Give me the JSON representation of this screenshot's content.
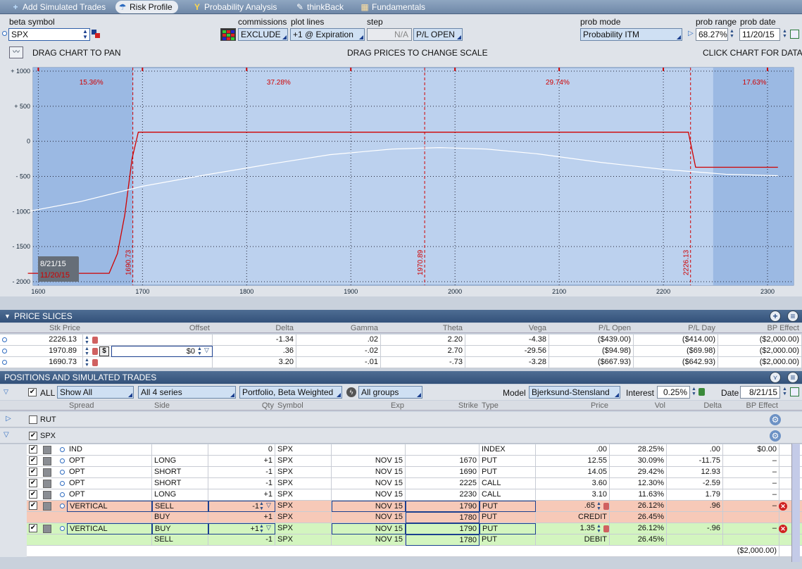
{
  "tabs": [
    {
      "label": "Add Simulated Trades",
      "icon": "+"
    },
    {
      "label": "Risk Profile",
      "icon": "☂"
    },
    {
      "label": "Probability Analysis",
      "icon": "Y"
    },
    {
      "label": "thinkBack",
      "icon": "✎"
    },
    {
      "label": "Fundamentals",
      "icon": "▦"
    }
  ],
  "controls": {
    "beta_symbol_label": "beta symbol",
    "beta_symbol": "SPX",
    "commissions_label": "commissions",
    "commissions": "EXCLUDE",
    "plot_lines_label": "plot lines",
    "plot_lines": "+1 @ Expiration",
    "step_label": "step",
    "step": "N/A",
    "pl_mode": "P/L OPEN",
    "prob_mode_label": "prob mode",
    "prob_mode": "Probability ITM",
    "prob_range_label": "prob range",
    "prob_range": "68.27%",
    "prob_date_label": "prob date",
    "prob_date": "11/20/15",
    "drag_pan": "DRAG CHART TO PAN",
    "drag_prices": "DRAG PRICES TO CHANGE SCALE",
    "click_chart": "CLICK CHART FOR DATA"
  },
  "chart_data": {
    "type": "line",
    "x_ticks": [
      "1600",
      "1700",
      "1800",
      "1900",
      "2000",
      "2100",
      "2200",
      "2300"
    ],
    "y_ticks": [
      "+ 1000",
      "+ 500",
      "0",
      "- 500",
      "- 1000",
      "- 1500",
      "- 2000"
    ],
    "xlim": [
      1595,
      2325
    ],
    "ylim": [
      -2050,
      1050
    ],
    "probabilities": [
      "15.36%",
      "37.28%",
      "29.74%",
      "17.63%"
    ],
    "markers": [
      {
        "x": 1690.73,
        "label": "1690.73"
      },
      {
        "x": 1970.89,
        "label": "1970.89"
      },
      {
        "x": 2226.13,
        "label": "2226.13"
      }
    ],
    "prob_bounds": [
      1690.73,
      2226.13
    ],
    "date_labels": [
      "8/21/15",
      "11/20/15"
    ],
    "series": [
      {
        "color": "#d00000",
        "points": [
          [
            1590,
            -1880
          ],
          [
            1668,
            -1880
          ],
          [
            1676,
            -1600
          ],
          [
            1683,
            -1050
          ],
          [
            1690,
            -250
          ],
          [
            1696,
            130
          ],
          [
            2224,
            130
          ],
          [
            2231,
            -370
          ],
          [
            2310,
            -370
          ]
        ]
      },
      {
        "color": "#ffffff",
        "points": [
          [
            1590,
            -1000
          ],
          [
            1640,
            -860
          ],
          [
            1700,
            -640
          ],
          [
            1760,
            -480
          ],
          [
            1820,
            -330
          ],
          [
            1880,
            -190
          ],
          [
            1940,
            -110
          ],
          [
            1985,
            -90
          ],
          [
            2030,
            -110
          ],
          [
            2080,
            -180
          ],
          [
            2140,
            -300
          ],
          [
            2200,
            -400
          ],
          [
            2260,
            -470
          ],
          [
            2310,
            -490
          ]
        ]
      }
    ]
  },
  "price_slices": {
    "title": "PRICE SLICES",
    "headers": [
      "Stk Price",
      "Offset",
      "Delta",
      "Gamma",
      "Theta",
      "Vega",
      "P/L Open",
      "P/L Day",
      "BP Effect"
    ],
    "rows": [
      {
        "price": "2226.13",
        "offset": "",
        "delta": "-1.34",
        "gamma": ".02",
        "theta": "2.20",
        "vega": "-4.38",
        "pl_open": "($439.00)",
        "pl_day": "($414.00)",
        "bp": "($2,000.00)"
      },
      {
        "price": "1970.89",
        "offset": "$0",
        "delta": ".36",
        "gamma": "-.02",
        "theta": "2.70",
        "vega": "-29.56",
        "pl_open": "($94.98)",
        "pl_day": "($69.98)",
        "bp": "($2,000.00)"
      },
      {
        "price": "1690.73",
        "offset": "",
        "delta": "3.20",
        "gamma": "-.01",
        "theta": "-.73",
        "vega": "-3.28",
        "pl_open": "($667.93)",
        "pl_day": "($642.93)",
        "bp": "($2,000.00)"
      }
    ]
  },
  "positions": {
    "title": "POSITIONS AND SIMULATED TRADES",
    "all_label": "ALL",
    "show": "Show All",
    "series": "All 4 series",
    "portfolio": "Portfolio, Beta Weighted",
    "groups": "All groups",
    "model_label": "Model",
    "model": "Bjerksund-Stensland",
    "interest_label": "Interest",
    "interest": "0.25%",
    "date_label": "Date",
    "date": "8/21/15",
    "headers": [
      "Spread",
      "Side",
      "Qty",
      "Symbol",
      "Exp",
      "Strike",
      "Type",
      "Price",
      "Vol",
      "Delta",
      "BP Effect"
    ],
    "groups_list": [
      "RUT",
      "SPX"
    ],
    "rows": [
      {
        "spread": "IND",
        "side": "",
        "qty": "0",
        "symbol": "SPX",
        "exp": "",
        "strike": "",
        "type": "INDEX",
        "price": ".00",
        "vol": "28.25%",
        "delta": ".00",
        "bp": "$0.00"
      },
      {
        "spread": "OPT",
        "side": "LONG",
        "qty": "+1",
        "symbol": "SPX",
        "exp": "NOV 15",
        "strike": "1670",
        "type": "PUT",
        "price": "12.55",
        "vol": "30.09%",
        "delta": "-11.75",
        "bp": "–"
      },
      {
        "spread": "OPT",
        "side": "SHORT",
        "qty": "-1",
        "symbol": "SPX",
        "exp": "NOV 15",
        "strike": "1690",
        "type": "PUT",
        "price": "14.05",
        "vol": "29.42%",
        "delta": "12.93",
        "bp": "–"
      },
      {
        "spread": "OPT",
        "side": "SHORT",
        "qty": "-1",
        "symbol": "SPX",
        "exp": "NOV 15",
        "strike": "2225",
        "type": "CALL",
        "price": "3.60",
        "vol": "12.30%",
        "delta": "-2.59",
        "bp": "–"
      },
      {
        "spread": "OPT",
        "side": "LONG",
        "qty": "+1",
        "symbol": "SPX",
        "exp": "NOV 15",
        "strike": "2230",
        "type": "CALL",
        "price": "3.10",
        "vol": "11.63%",
        "delta": "1.79",
        "bp": "–"
      }
    ],
    "sim_rows": [
      {
        "spread": "VERTICAL",
        "side": "SELL",
        "qty": "-1",
        "symbol": "SPX",
        "exp": "NOV 15",
        "strike": "1790",
        "type": "PUT",
        "price": ".65",
        "vol": "26.12%",
        "delta": ".96",
        "bp": "–"
      },
      {
        "spread": "",
        "side": "BUY",
        "qty": "+1",
        "symbol": "SPX",
        "exp": "NOV 15",
        "strike": "1780",
        "type": "PUT",
        "price": "CREDIT",
        "vol": "26.45%",
        "delta": "",
        "bp": ""
      },
      {
        "spread": "VERTICAL",
        "side": "BUY",
        "qty": "+1",
        "symbol": "SPX",
        "exp": "NOV 15",
        "strike": "1790",
        "type": "PUT",
        "price": "1.35",
        "vol": "26.12%",
        "delta": "-.96",
        "bp": "–"
      },
      {
        "spread": "",
        "side": "SELL",
        "qty": "-1",
        "symbol": "SPX",
        "exp": "NOV 15",
        "strike": "1780",
        "type": "PUT",
        "price": "DEBIT",
        "vol": "26.45%",
        "delta": "",
        "bp": ""
      }
    ],
    "total_bp": "($2,000.00)"
  }
}
